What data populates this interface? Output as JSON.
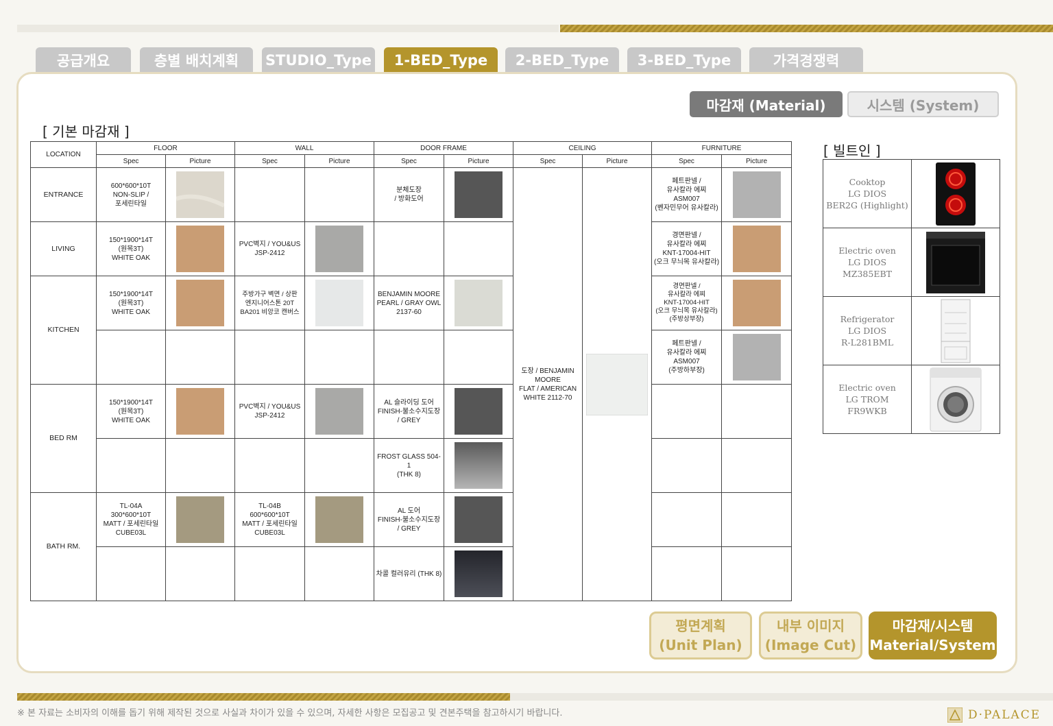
{
  "tabs": [
    "공급개요",
    "층별 배치계획",
    "STUDIO_Type",
    "1-BED_Type",
    "2-BED_Type",
    "3-BED_Type",
    "가격경쟁력"
  ],
  "active_tab": "1-BED_Type",
  "segments": {
    "material": "마감재 (Material)",
    "system": "시스템 (System)"
  },
  "titles": {
    "basic": "기본 마감재",
    "builtin": "빌트인"
  },
  "table": {
    "location_header": "LOCATION",
    "groups": [
      "FLOOR",
      "WALL",
      "DOOR FRAME",
      "CEILING",
      "FURNITURE"
    ],
    "spec_label": "Spec",
    "picture_label": "Picture",
    "locations": {
      "entrance": "ENTRANCE",
      "living": "LIVING",
      "kitchen": "KITCHEN",
      "bed": "BED RM",
      "bath": "BATH RM."
    },
    "cells": {
      "entrance_floor": "600*600*10T\nNON-SLIP /\n포세린타일",
      "entrance_door": "분체도장\n/ 방화도어",
      "entrance_furn": "페트판넬 /\n유사칼라 에찌\nASM007\n(벤자민무어 유사칼라)",
      "living_floor": "150*1900*14T\n(원목3T)\nWHITE OAK",
      "living_wall": "PVC벽지 / YOU&US\nJSP-2412",
      "living_furn": "경면판넬 /\n유사칼라 에찌\nKNT-17004-HIT\n(오크 무늬목 유사칼라)",
      "kitchen_floor": "150*1900*14T\n(원목3T)\nWHITE OAK",
      "kitchen_wall": "주방가구 벽면 / 상판\n엔지니어스톤 20T\nBA201 비앙코 캔버스",
      "kitchen_door": "BENJAMIN MOORE\nPEARL / GRAY OWL\n2137-60",
      "kitchen_furn1": "경면판넬 /\n유사칼라 에찌\nKNT-17004-HIT\n(오크 무늬목 유사칼라)\n(주방상부장)",
      "kitchen_furn2": "페트판넬 /\n유사칼라 에찌\nASM007\n(주방하부장)",
      "ceiling": "도장 / BENJAMIN\nMOORE\nFLAT / AMERICAN\nWHITE 2112-70",
      "bed_floor": "150*1900*14T\n(원목3T)\nWHITE OAK",
      "bed_wall": "PVC벽지 / YOU&US\nJSP-2412",
      "bed_door1": "AL 슬라이딩 도어\nFINISH-불소수지도장\n/ GREY",
      "bed_door2": "FROST GLASS 504-\n1\n(THK 8)",
      "bath_floor": "TL-04A\n300*600*10T\nMATT / 포세린타일\nCUBE03L",
      "bath_wall": "TL-04B\n600*600*10T\nMATT / 포세린타일\nCUBE03L",
      "bath_door1": "AL 도어\nFINISH-불소수지도장\n/ GREY",
      "bath_door2": "차콜 컬러유리 (THK 8)"
    }
  },
  "builtin": [
    {
      "name": "Cooktop",
      "brand": "LG DIOS",
      "model": "BER2G (Highlight)",
      "icon": "cooktop-icon"
    },
    {
      "name": "Electric oven",
      "brand": "LG DIOS",
      "model": "MZ385EBT",
      "icon": "oven-icon"
    },
    {
      "name": "Refrigerator",
      "brand": "LG DIOS",
      "model": "R-L281BML",
      "icon": "refrigerator-icon"
    },
    {
      "name": "Electric oven",
      "brand": "LG TROM",
      "model": "FR9WKB",
      "icon": "washer-icon"
    }
  ],
  "nav_buttons": {
    "unit_plan": "평면계획\n(Unit Plan)",
    "image_cut": "내부 이미지\n(Image Cut)",
    "material_system": "마감재/시스템\n(Material/System)"
  },
  "footer": {
    "note": "※ 본 자료는 소비자의 이해를 돕기 위해 제작된 것으로 사실과 차이가 있을 수 있으며, 자세한 사항은 모집공고 및 견본주택을 참고하시기 바랍니다.",
    "logo": "D·PALACE"
  },
  "colors": {
    "gold": "#b4952c",
    "tab_gray": "#c8c8c8",
    "swatch_oak": "#c99d74",
    "swatch_grey": "#565656",
    "swatch_stone": "#ddd8cc",
    "swatch_bath": "#a49a80"
  }
}
